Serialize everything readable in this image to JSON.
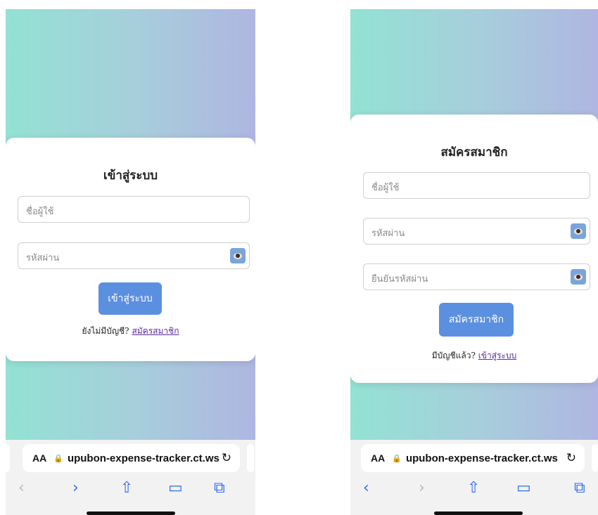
{
  "login": {
    "title": "เข้าสู่ระบบ",
    "username_placeholder": "ชื่อผู้ใช้",
    "password_placeholder": "รหัสผ่าน",
    "submit_label": "เข้าสู่ระบบ",
    "hint_text": "ยังไม่มีบัญชี?",
    "hint_link": "สมัครสมาชิก"
  },
  "register": {
    "title": "สมัครสมาชิก",
    "username_placeholder": "ชื่อผู้ใช้",
    "password_placeholder": "รหัสผ่าน",
    "confirm_placeholder": "ยืนยันรหัสผ่าน",
    "submit_label": "สมัครสมาชิก",
    "hint_text": "มีบัญชีแล้ว?",
    "hint_link": "เข้าสู่ระบบ"
  },
  "browser": {
    "text_size_label": "AA",
    "url": "upubon-expense-tracker.ct.ws",
    "icons": [
      "lock-icon",
      "reload-icon",
      "back-icon",
      "forward-icon",
      "share-icon",
      "bookmarks-icon",
      "tabs-icon",
      "eye-icon"
    ]
  },
  "colors": {
    "gradient_start": "#93e2d4",
    "gradient_end": "#afb6e1",
    "button": "#5b8fe0",
    "link": "#5b2aa0",
    "nav_active": "#2f6df0"
  }
}
